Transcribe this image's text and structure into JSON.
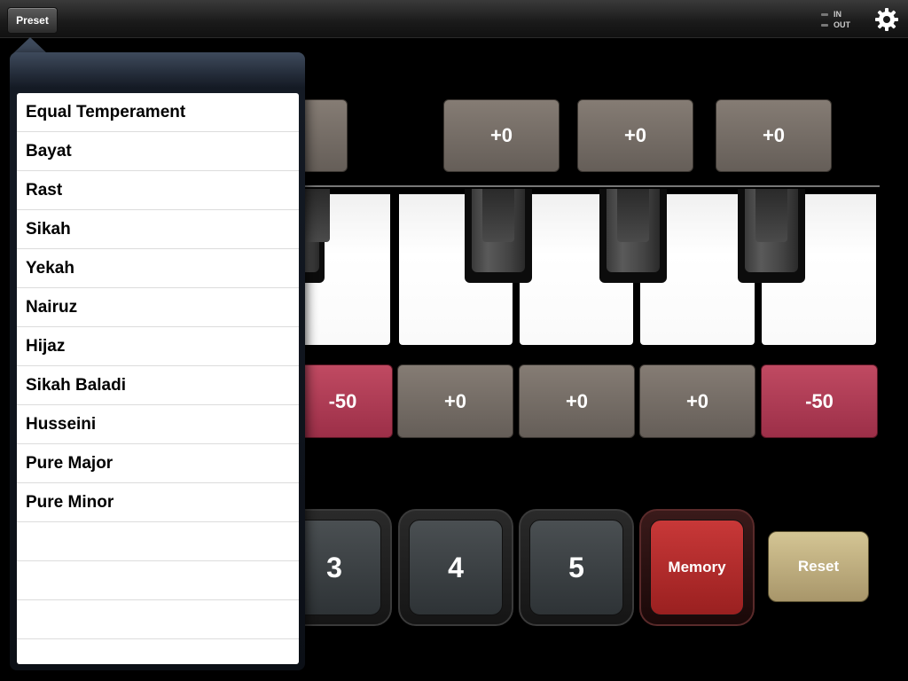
{
  "topbar": {
    "preset_label": "Preset",
    "io": {
      "in_label": "IN",
      "out_label": "OUT"
    }
  },
  "icons": {
    "settings": "gear-icon"
  },
  "offsets_top": [
    "+0",
    "+0",
    "+0"
  ],
  "offsets_bottom": [
    "-50",
    "+0",
    "+0",
    "+0",
    "-50"
  ],
  "memory_buttons": [
    "3",
    "4",
    "5"
  ],
  "memory_label": "Memory",
  "reset_label": "Reset",
  "preset_menu": {
    "items": [
      "Equal Temperament",
      "Bayat",
      "Rast",
      "Sikah",
      "Yekah",
      "Nairuz",
      "Hijaz",
      "Sikah Baladi",
      "Husseini",
      "Pure Major",
      "Pure Minor",
      "",
      "",
      "",
      ""
    ]
  },
  "colors": {
    "red_tile": "#b03c55",
    "gray_tile": "#776f68",
    "memory": "#b82c2c",
    "reset": "#c2b282"
  }
}
